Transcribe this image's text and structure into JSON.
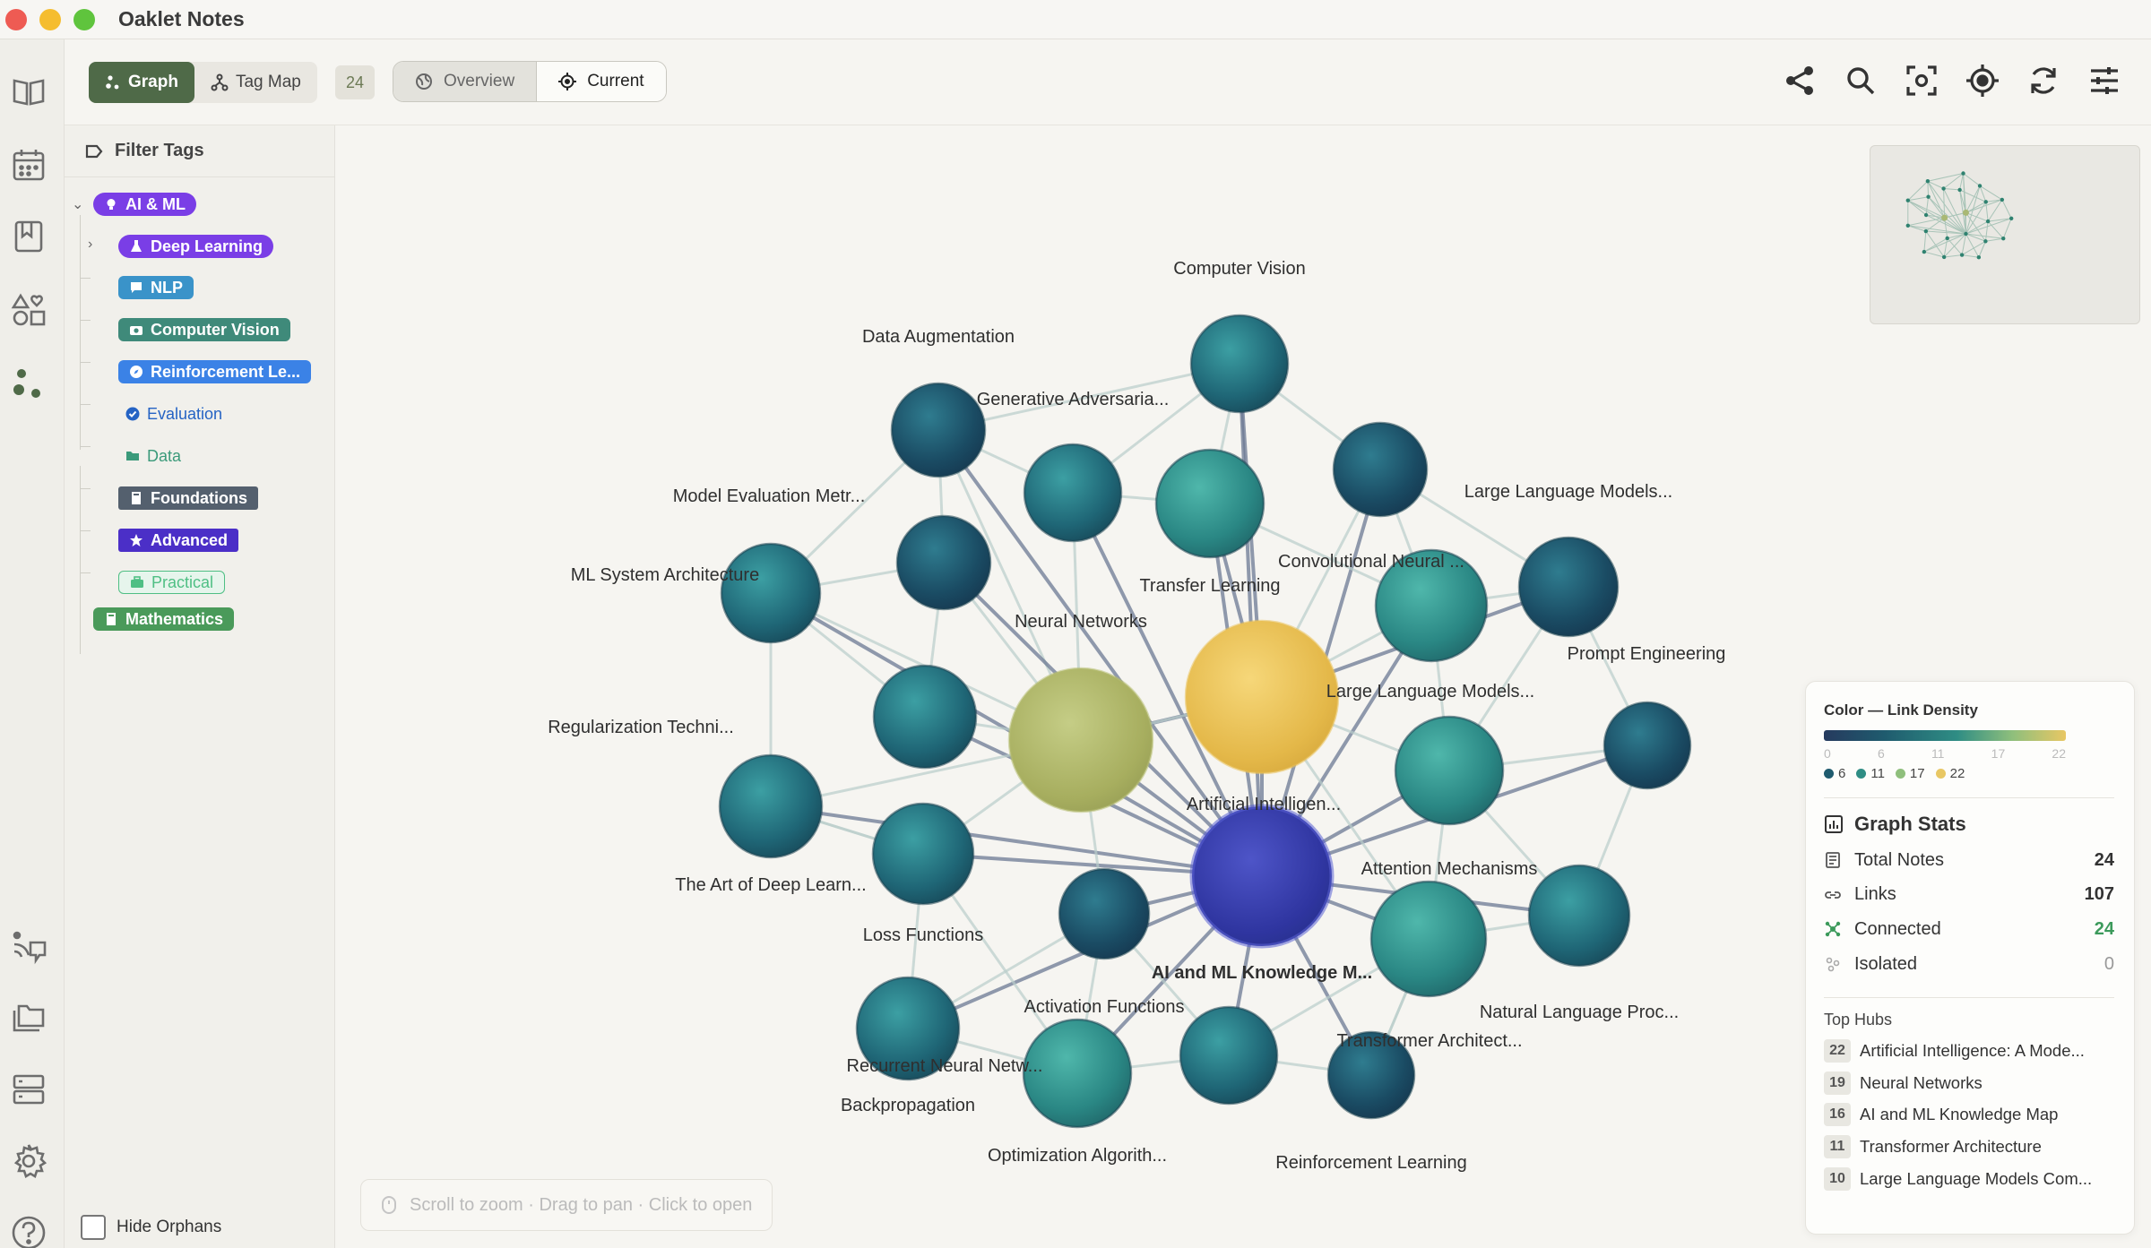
{
  "app": {
    "title": "Oaklet Notes"
  },
  "toolbar": {
    "graph_label": "Graph",
    "tagmap_label": "Tag Map",
    "count": "24",
    "overview_label": "Overview",
    "current_label": "Current"
  },
  "filter": {
    "title": "Filter Tags",
    "tags": [
      {
        "label": "AI & ML",
        "color": "#7a3ee6"
      },
      {
        "label": "Deep Learning",
        "color": "#7a3ee6"
      },
      {
        "label": "NLP",
        "color": "#3a93c9"
      },
      {
        "label": "Computer Vision",
        "color": "#3f8a7a"
      },
      {
        "label": "Reinforcement Le...",
        "color": "#3b82e6"
      },
      {
        "label": "Evaluation",
        "color": "#2563c4"
      },
      {
        "label": "Data",
        "color": "#3b9a7a"
      },
      {
        "label": "Foundations",
        "color": "#54606e"
      },
      {
        "label": "Advanced",
        "color": "#4b2fc7"
      },
      {
        "label": "Practical",
        "color": "#4fbf84"
      },
      {
        "label": "Mathematics",
        "color": "#4a9a5a"
      }
    ],
    "hide_orphans": "Hide Orphans"
  },
  "graph": {
    "hint": "Scroll to zoom · Drag to pan · Click to open",
    "labels": [
      "Computer Vision",
      "Data Augmentation",
      "Generative Adversaria...",
      "Model Evaluation Metr...",
      "Large Language Models...",
      "Convolutional Neural ...",
      "Transfer Learning",
      "ML System Architecture",
      "Neural Networks",
      "Prompt Engineering",
      "Large Language Models...",
      "Regularization Techni...",
      "Artificial Intelligen...",
      "Attention Mechanisms",
      "The Art of Deep Learn...",
      "Loss Functions",
      "AI and ML Knowledge M...",
      "Activation Functions",
      "Natural Language Proc...",
      "Transformer Architect...",
      "Recurrent Neural Netw...",
      "Backpropagation",
      "Optimization Algorith...",
      "Reinforcement Learning"
    ]
  },
  "legend": {
    "title": "Color — Link Density",
    "ticks": [
      "0",
      "6",
      "11",
      "17",
      "22"
    ],
    "dots": [
      "6",
      "11",
      "17",
      "22"
    ],
    "dot_colors": [
      "#1f5b6e",
      "#2f8d84",
      "#8fbf7c",
      "#e8c764"
    ]
  },
  "stats": {
    "title": "Graph Stats",
    "total_notes_label": "Total Notes",
    "total_notes": "24",
    "links_label": "Links",
    "links": "107",
    "connected_label": "Connected",
    "connected": "24",
    "isolated_label": "Isolated",
    "isolated": "0",
    "top_hubs_title": "Top Hubs",
    "hubs": [
      {
        "count": "22",
        "name": "Artificial Intelligence: A Mode..."
      },
      {
        "count": "19",
        "name": "Neural Networks"
      },
      {
        "count": "16",
        "name": "AI and ML Knowledge Map"
      },
      {
        "count": "11",
        "name": "Transformer Architecture"
      },
      {
        "count": "10",
        "name": "Large Language Models Com..."
      }
    ]
  }
}
